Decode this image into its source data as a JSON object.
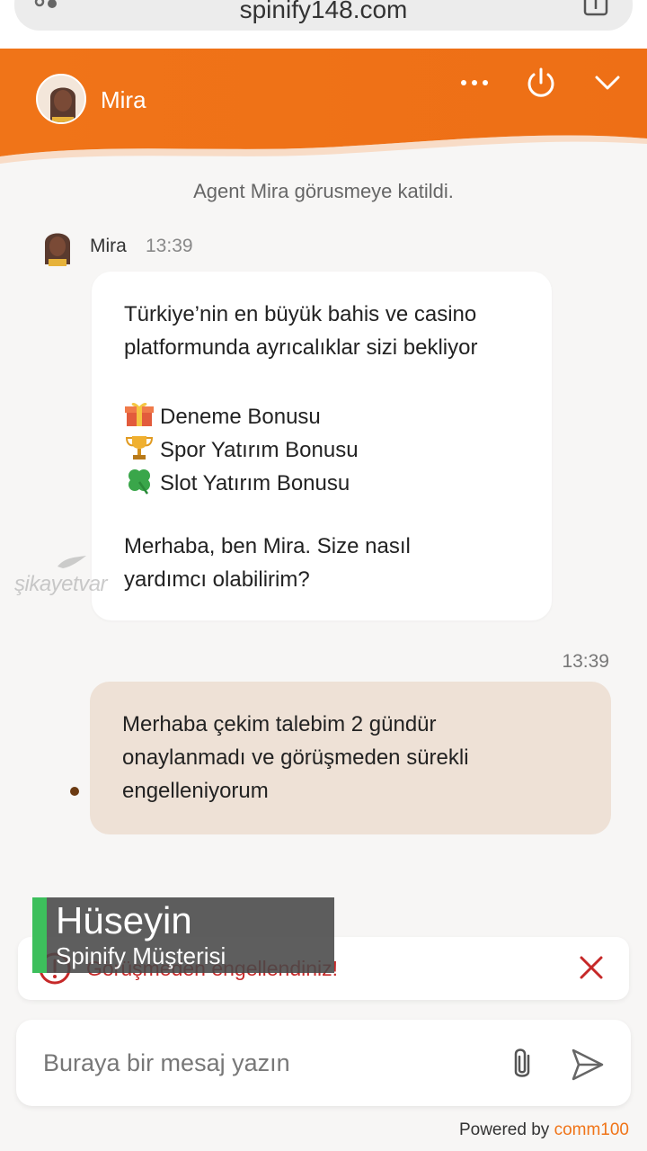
{
  "browser": {
    "url": "spinify148.com"
  },
  "header": {
    "agent_name": "Mira",
    "accent_color": "#f07418",
    "buttons": [
      "more-icon",
      "power-icon",
      "chevron-down-icon"
    ]
  },
  "chat": {
    "system_message": "Agent Mira görusmeye katildi.",
    "agent_message": {
      "author": "Mira",
      "time": "13:39",
      "lines": [
        "Türkiye’nin en büyük bahis ve casino",
        "platformunda ayrıcalıklar sizi bekliyor",
        "Deneme Bonusu",
        "Spor Yatırım Bonusu",
        "Slot Yatırım Bonusu",
        "Merhaba, ben Mira. Size nasıl",
        "yardımcı olabilirim?"
      ]
    },
    "user_message": {
      "time": "13:39",
      "lines": [
        "Merhaba çekim talebim 2 gündür",
        "onaylanmadı ve görüşmeden sürekli",
        "engelleniyorum"
      ]
    }
  },
  "watermark": "şikayetvar",
  "error": {
    "text": "Görüşmeden engellendiniz!"
  },
  "caption": {
    "name": "Hüseyin",
    "subtitle": "Spinify Müşterisi"
  },
  "composer": {
    "placeholder": "Buraya bir mesaj yazın"
  },
  "footer": {
    "powered_by": "Powered by",
    "brand": "comm100"
  }
}
